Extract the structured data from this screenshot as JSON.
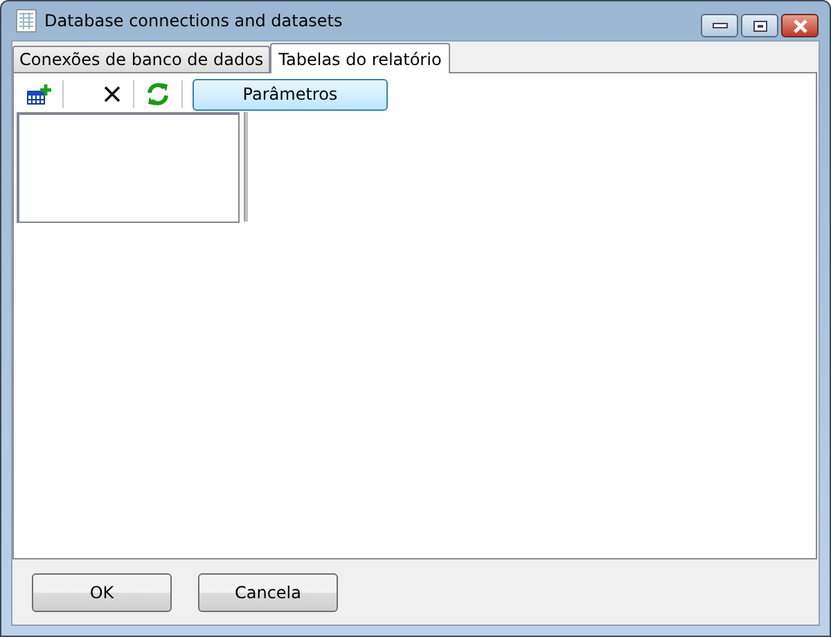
{
  "window": {
    "title": "Database connections and datasets"
  },
  "tabs": [
    {
      "label": "Conexões de banco de dados",
      "selected": false
    },
    {
      "label": "Tabelas do relatório",
      "selected": true
    }
  ],
  "toolbar": {
    "button": "Parâmetros"
  },
  "buttons": [
    "OK",
    "Cancela"
  ]
}
